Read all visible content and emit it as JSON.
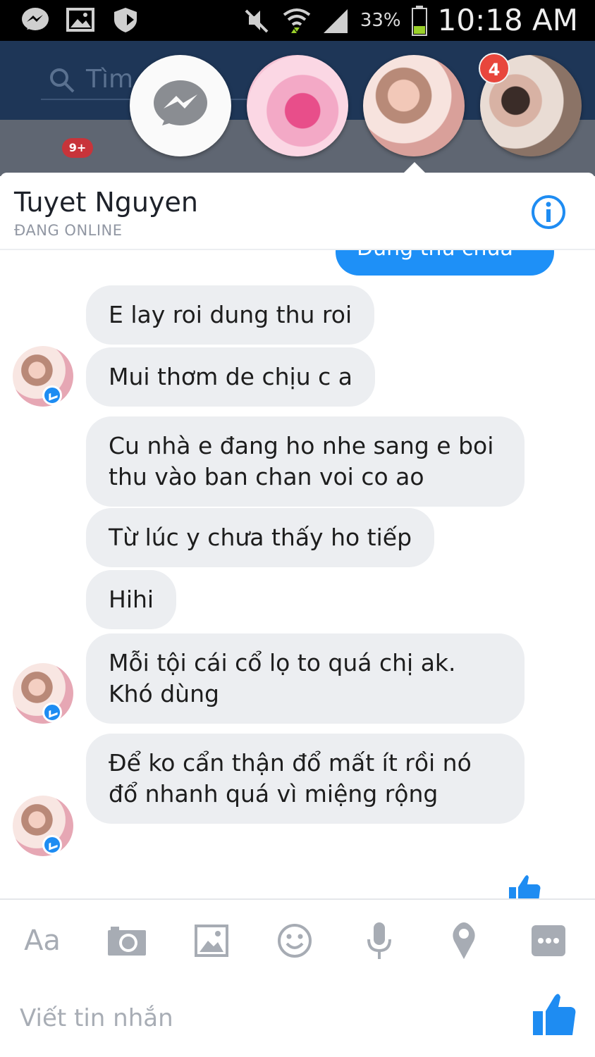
{
  "status_bar": {
    "battery_percent": "33%",
    "time": "10:18 AM",
    "left_icons": [
      "messenger-icon",
      "image-icon",
      "shield-icon"
    ],
    "right_icons": [
      "mute-icon",
      "wifi-icon",
      "signal-icon",
      "battery-icon"
    ]
  },
  "app_header": {
    "search_placeholder": "Tìm",
    "tab_badge": "9+"
  },
  "chat_heads": {
    "items": [
      "messenger",
      "contact-1",
      "contact-2",
      "contact-3"
    ],
    "badge_count": "4"
  },
  "conversation": {
    "contact_name": "Tuyet Nguyen",
    "contact_status": "ĐANG ONLINE",
    "sent_peek_text": "Dùng thử chưa",
    "messages": [
      {
        "text": "E lay roi dung thu roi"
      },
      {
        "text": "Mui thơm de chịu c a"
      },
      {
        "text": "Cu nhà e đang ho nhe sang e boi thu vào ban chan voi co ao"
      },
      {
        "text": "Từ lúc y chưa thấy ho tiếp"
      },
      {
        "text": "Hihi"
      },
      {
        "text": "Mỗi tội cái cổ lọ to quá chị ak. Khó dùng"
      },
      {
        "text": "Để ko cẩn thận đổ mất ít rồi nó đổ nhanh quá vì miệng rộng"
      }
    ]
  },
  "composer": {
    "aa_label": "Aa",
    "placeholder": "Viết tin nhắn",
    "tools": [
      "text-tool",
      "camera-icon",
      "image-icon",
      "emoji-icon",
      "microphone-icon",
      "location-icon",
      "more-icon",
      "like-icon"
    ]
  },
  "colors": {
    "accent_blue": "#1e90f7",
    "bubble_gray": "#eceef1",
    "header_navy": "#1e3657",
    "badge_red": "#e8463c"
  }
}
